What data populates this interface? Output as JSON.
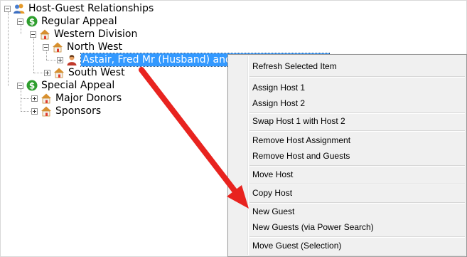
{
  "tree": {
    "root": "Host-Guest Relationships",
    "regular_appeal": "Regular Appeal",
    "western_division": "Western Division",
    "north_west": "North West",
    "selected_item": "Astair, Fred Mr (Husband) and A",
    "south_west": "South West",
    "special_appeal": "Special Appeal",
    "major_donors": "Major Donors",
    "sponsors": "Sponsors"
  },
  "context_menu": {
    "items": [
      "Refresh Selected Item",
      "Assign Host 1",
      "Assign Host 2",
      "Swap Host 1 with Host 2",
      "Remove Host Assignment",
      "Remove Host and Guests",
      "Move Host",
      "Copy Host",
      "New Guest",
      "New Guests (via Power Search)",
      "Move Guest (Selection)"
    ]
  },
  "colors": {
    "selection": "#3399ff",
    "arrow": "#e8231f",
    "dollar_icon": "#2e9e2e",
    "folder_house": "#d8902e"
  }
}
